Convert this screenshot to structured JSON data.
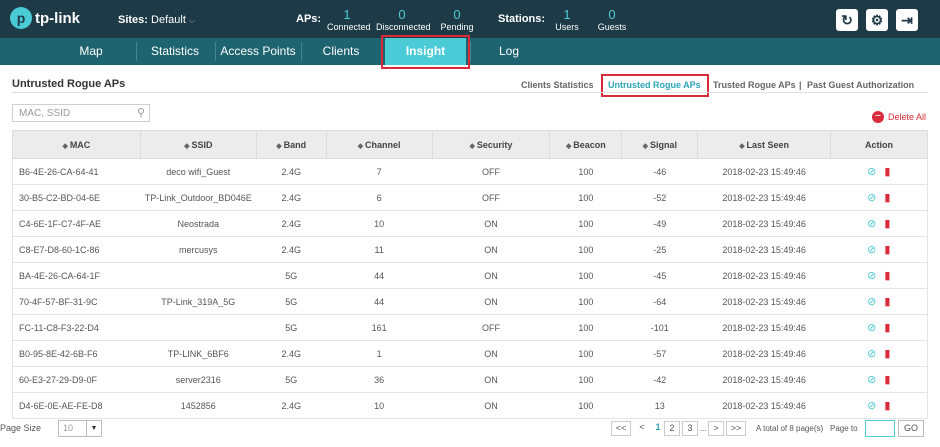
{
  "app": {
    "logo_glyph": "p",
    "logo_text": "tp-link",
    "sites_label": "Sites:",
    "site_value": "Default",
    "aps_label": "APs:",
    "aps": [
      {
        "num": "1",
        "label": "Connected"
      },
      {
        "num": "0",
        "label": "Disconnected"
      },
      {
        "num": "0",
        "label": "Pending"
      }
    ],
    "stations_label": "Stations:",
    "stations": [
      {
        "num": "1",
        "label": "Users"
      },
      {
        "num": "0",
        "label": "Guests"
      }
    ],
    "accent": "#4acbd6",
    "header_bg": "#1d3a46",
    "nav_bg": "#1e6370"
  },
  "nav": {
    "items": [
      "Map",
      "Statistics",
      "Access Points",
      "Clients",
      "Insight",
      "Log"
    ],
    "active": "Insight"
  },
  "page": {
    "title": "Untrusted Rogue APs",
    "subtabs": [
      "Clients Statistics",
      "Untrusted Rogue APs",
      "Trusted Rogue APs",
      "Past Guest Authorization"
    ],
    "subtab_sep": "|",
    "active_subtab": "Untrusted Rogue APs",
    "search_placeholder": "MAC, SSID",
    "delete_all": "Delete All"
  },
  "table": {
    "columns": [
      "MAC",
      "SSID",
      "Band",
      "Channel",
      "Security",
      "Beacon",
      "Signal",
      "Last Seen",
      "Action"
    ],
    "rows": [
      [
        "B6-4E-26-CA-64-41",
        "deco wifi_Guest",
        "2.4G",
        "7",
        "OFF",
        "100",
        "-46",
        "2018-02-23 15:49:46"
      ],
      [
        "30-B5-C2-BD-04-6E",
        "TP-Link_Outdoor_BD046E",
        "2.4G",
        "6",
        "OFF",
        "100",
        "-52",
        "2018-02-23 15:49:46"
      ],
      [
        "C4-6E-1F-C7-4F-AE",
        "Neostrada",
        "2.4G",
        "10",
        "ON",
        "100",
        "-49",
        "2018-02-23 15:49:46"
      ],
      [
        "C8-E7-D8-60-1C-86",
        "mercusys",
        "2.4G",
        "11",
        "ON",
        "100",
        "-25",
        "2018-02-23 15:49:46"
      ],
      [
        "BA-4E-26-CA-64-1F",
        "",
        "5G",
        "44",
        "ON",
        "100",
        "-45",
        "2018-02-23 15:49:46"
      ],
      [
        "70-4F-57-BF-31-9C",
        "TP-Link_319A_5G",
        "5G",
        "44",
        "ON",
        "100",
        "-64",
        "2018-02-23 15:49:46"
      ],
      [
        "FC-11-C8-F3-22-D4",
        "",
        "5G",
        "161",
        "OFF",
        "100",
        "-101",
        "2018-02-23 15:49:46"
      ],
      [
        "B0-95-8E-42-6B-F6",
        "TP-LINK_6BF6",
        "2.4G",
        "1",
        "ON",
        "100",
        "-57",
        "2018-02-23 15:49:46"
      ],
      [
        "60-E3-27-29-D9-0F",
        "server2316",
        "5G",
        "36",
        "ON",
        "100",
        "-42",
        "2018-02-23 15:49:46"
      ],
      [
        "D4-6E-0E-AE-FE-D8",
        "1452856",
        "2.4G",
        "10",
        "ON",
        "100",
        "13",
        "2018-02-23 15:49:46"
      ]
    ]
  },
  "footer": {
    "page_size_label": "Page Size",
    "page_size_value": "10",
    "pager_first": "<<",
    "pager_prev": "<",
    "pages": [
      "1",
      "2",
      "3"
    ],
    "ellipsis": "...",
    "pager_next": ">",
    "pager_last": ">>",
    "current_page": "1",
    "total_text": "A total of 8 page(s)",
    "page_to_label": "Page to",
    "go_label": "GO"
  },
  "icons": {
    "refresh": "refresh-icon",
    "settings": "gear-icon",
    "logout": "logout-icon",
    "search": "search-icon",
    "block": "block-icon",
    "trash": "trash-icon"
  }
}
